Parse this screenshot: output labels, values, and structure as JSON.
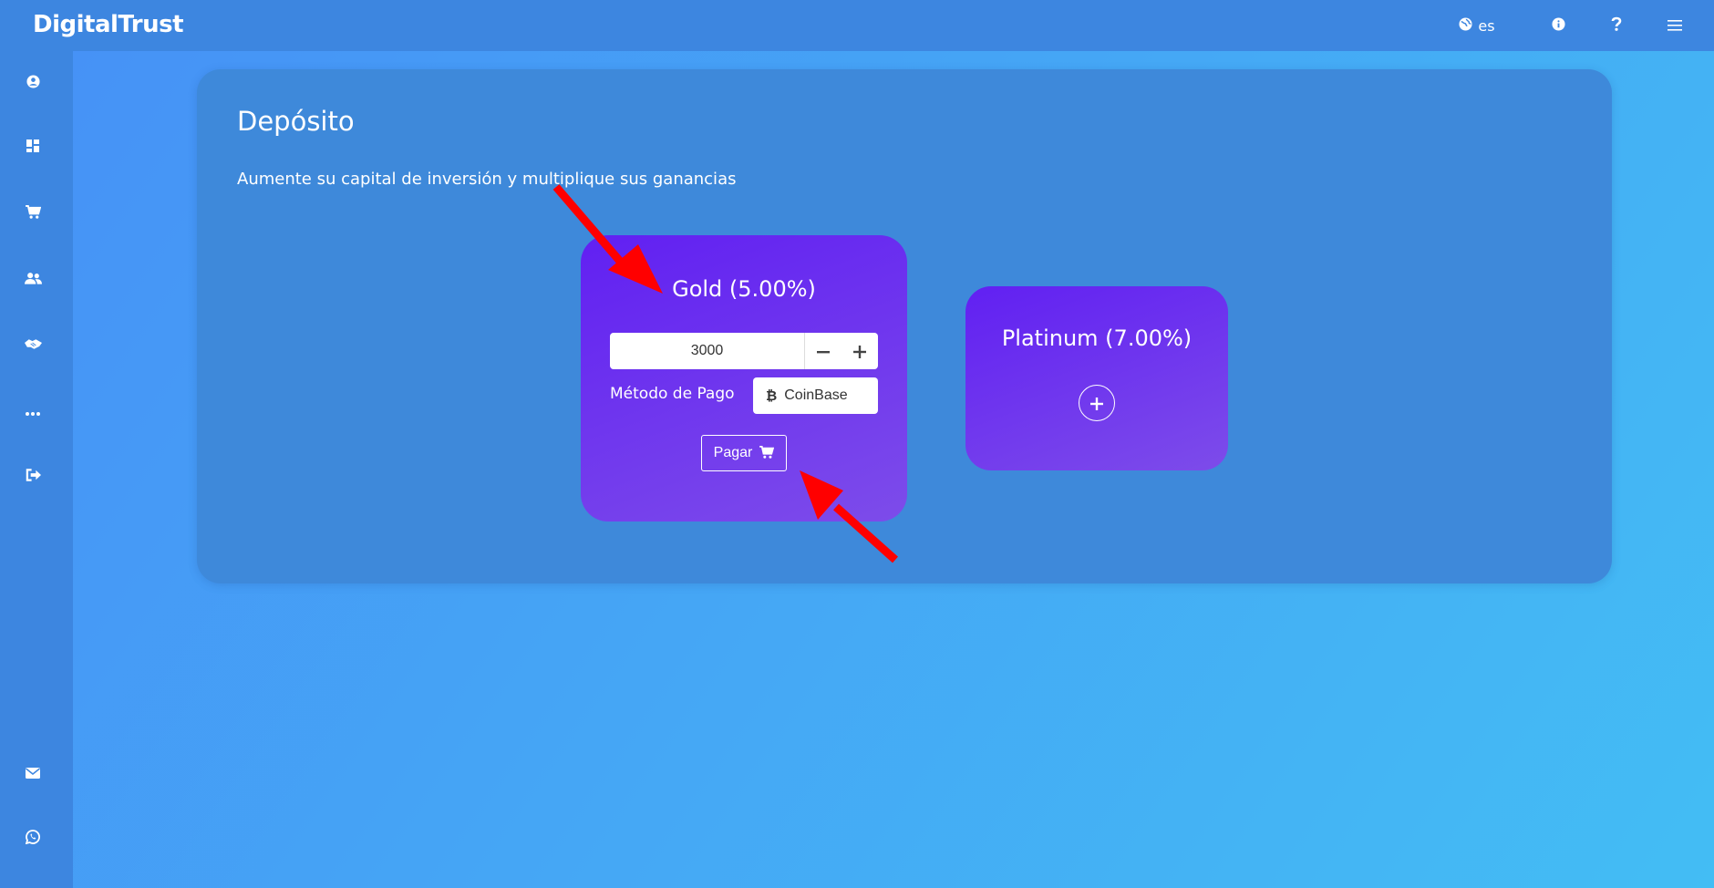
{
  "brand": "DigitalTrust",
  "topnav": {
    "language": "es",
    "icons": [
      "globe-icon",
      "info-icon",
      "help-icon",
      "menu-icon"
    ]
  },
  "sidebar": {
    "items": [
      {
        "icon": "user-circle-icon"
      },
      {
        "icon": "dashboard-icon"
      },
      {
        "icon": "cart-icon"
      },
      {
        "icon": "users-icon"
      },
      {
        "icon": "handshake-icon"
      },
      {
        "icon": "more-icon"
      },
      {
        "icon": "logout-icon"
      },
      {
        "icon": "mail-icon"
      },
      {
        "icon": "whatsapp-icon"
      }
    ]
  },
  "panel": {
    "title": "Depósito",
    "subtitle": "Aumente su capital de inversión y multiplique sus ganancias"
  },
  "plans": [
    {
      "title": "Gold (5.00%)",
      "amount": "3000",
      "payment_method_label": "Método de Pago",
      "payment_method": "CoinBase",
      "pay_label": "Pagar"
    },
    {
      "title": "Platinum (7.00%)"
    }
  ],
  "colors": {
    "topbar": "#3d86e0",
    "panel": "#3e89da",
    "card_start": "#6120f2",
    "card_end": "#7d4cea",
    "annotation_arrow": "#ff0000"
  }
}
